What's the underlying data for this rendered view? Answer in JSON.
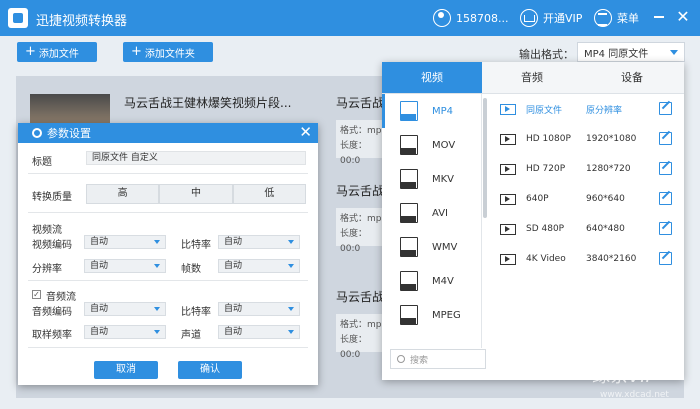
{
  "titlebar": {
    "app_title": "迅捷视频转换器",
    "user": "158708...",
    "vip": "开通VIP",
    "menu": "菜单"
  },
  "toolbar": {
    "add_file": "添加文件",
    "add_folder": "添加文件夹",
    "output_format_label": "输出格式：",
    "output_format_value": "MP4 同原文件"
  },
  "files": {
    "first_name": "马云舌战王健林爆笑视频片段...",
    "target_name": "马云舌战",
    "format_label": "格式：mp",
    "length_label": "长度：00:0"
  },
  "dialog": {
    "title": "参数设置",
    "title_label": "标题",
    "title_value": "同原文件 自定义",
    "quality_label": "转换质量",
    "quality_options": [
      "高",
      "中",
      "低"
    ],
    "video_stream": "视频流",
    "video_codec_label": "视频编码",
    "video_codec_value": "自动",
    "bitrate_label": "比特率",
    "bitrate_value": "自动",
    "resolution_label": "分辨率",
    "resolution_value": "自动",
    "fps_label": "帧数",
    "fps_value": "自动",
    "audio_stream": "音频流",
    "audio_codec_label": "音频编码",
    "audio_codec_value": "自动",
    "audio_bitrate_label": "比特率",
    "audio_bitrate_value": "自动",
    "sample_rate_label": "取样频率",
    "sample_rate_value": "自动",
    "channel_label": "声道",
    "channel_value": "自动",
    "cancel": "取消",
    "ok": "确认"
  },
  "format_panel": {
    "tabs": [
      "视频",
      "音频",
      "设备"
    ],
    "formats": [
      "MP4",
      "MOV",
      "MKV",
      "AVI",
      "WMV",
      "M4V",
      "MPEG"
    ],
    "format_badges": [
      "MP4",
      "MOV",
      "MKV",
      "AVI",
      "WMV",
      "M4V",
      "MPEG"
    ],
    "presets": [
      {
        "name": "同原文件",
        "value": "原分辨率"
      },
      {
        "name": "HD 1080P",
        "value": "1920*1080"
      },
      {
        "name": "HD 720P",
        "value": "1280*720"
      },
      {
        "name": "640P",
        "value": "960*640"
      },
      {
        "name": "SD 480P",
        "value": "640*480"
      },
      {
        "name": "4K Video",
        "value": "3840*2160"
      }
    ],
    "search_placeholder": "搜索"
  },
  "watermark": {
    "text": "绿茶VIP",
    "sub": "www.xdcad.net"
  }
}
